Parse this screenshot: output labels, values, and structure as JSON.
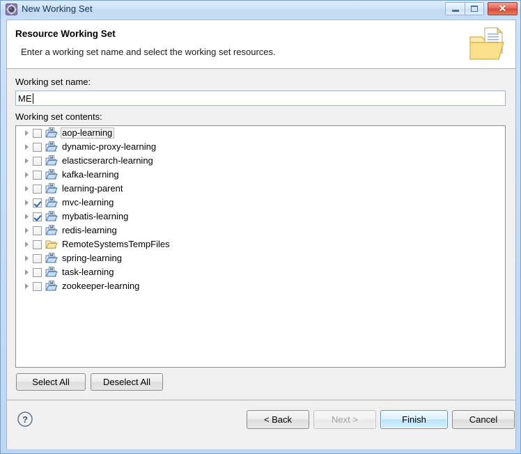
{
  "window": {
    "title": "New Working Set",
    "icon": "eclipse-wizard-icon",
    "controls": {
      "minimize": "minimize-icon",
      "maximize": "maximize-icon",
      "close": "✕"
    }
  },
  "banner": {
    "title": "Resource Working Set",
    "description": "Enter a working set name and select the working set resources.",
    "icon": "folder-document-icon"
  },
  "form": {
    "name_label": "Working set name:",
    "name_value": "ME",
    "name_placeholder": "",
    "contents_label": "Working set contents:"
  },
  "tree": {
    "items": [
      {
        "label": "aop-learning",
        "checked": false,
        "focused": true,
        "icon": "maven-project-folder-icon",
        "expandable": true
      },
      {
        "label": "dynamic-proxy-learning",
        "checked": false,
        "focused": false,
        "icon": "maven-project-folder-icon",
        "expandable": true
      },
      {
        "label": "elasticserarch-learning",
        "checked": false,
        "focused": false,
        "icon": "maven-project-folder-icon",
        "expandable": true
      },
      {
        "label": "kafka-learning",
        "checked": false,
        "focused": false,
        "icon": "maven-project-folder-icon",
        "expandable": true
      },
      {
        "label": "learning-parent",
        "checked": false,
        "focused": false,
        "icon": "maven-project-folder-icon",
        "expandable": true
      },
      {
        "label": "mvc-learning",
        "checked": true,
        "focused": false,
        "icon": "maven-project-folder-icon",
        "expandable": true
      },
      {
        "label": "mybatis-learning",
        "checked": true,
        "focused": false,
        "icon": "maven-project-folder-icon",
        "expandable": true
      },
      {
        "label": "redis-learning",
        "checked": false,
        "focused": false,
        "icon": "maven-project-folder-icon",
        "expandable": true
      },
      {
        "label": "RemoteSystemsTempFiles",
        "checked": false,
        "focused": false,
        "icon": "plain-folder-icon",
        "expandable": true
      },
      {
        "label": "spring-learning",
        "checked": false,
        "focused": false,
        "icon": "maven-project-folder-icon",
        "expandable": true
      },
      {
        "label": "task-learning",
        "checked": false,
        "focused": false,
        "icon": "maven-project-folder-icon",
        "expandable": true
      },
      {
        "label": "zookeeper-learning",
        "checked": false,
        "focused": false,
        "icon": "maven-project-folder-icon",
        "expandable": true
      }
    ]
  },
  "selection_buttons": {
    "select_all": "Select All",
    "deselect_all": "Deselect All"
  },
  "footer": {
    "help_icon": "help-question-icon",
    "back": "< Back",
    "next": "Next >",
    "finish": "Finish",
    "cancel": "Cancel",
    "default_button": "Finish",
    "disabled_buttons": [
      "Next >"
    ]
  },
  "colors": {
    "titlebar": "#cfe3f7",
    "client_bg": "#f0f0f0",
    "banner_bg": "#ffffff",
    "tree_bg": "#ffffff",
    "default_button_border": "#3c9fd4",
    "checkbox_check": "#2a63b8",
    "close_button": "#d44a36"
  }
}
